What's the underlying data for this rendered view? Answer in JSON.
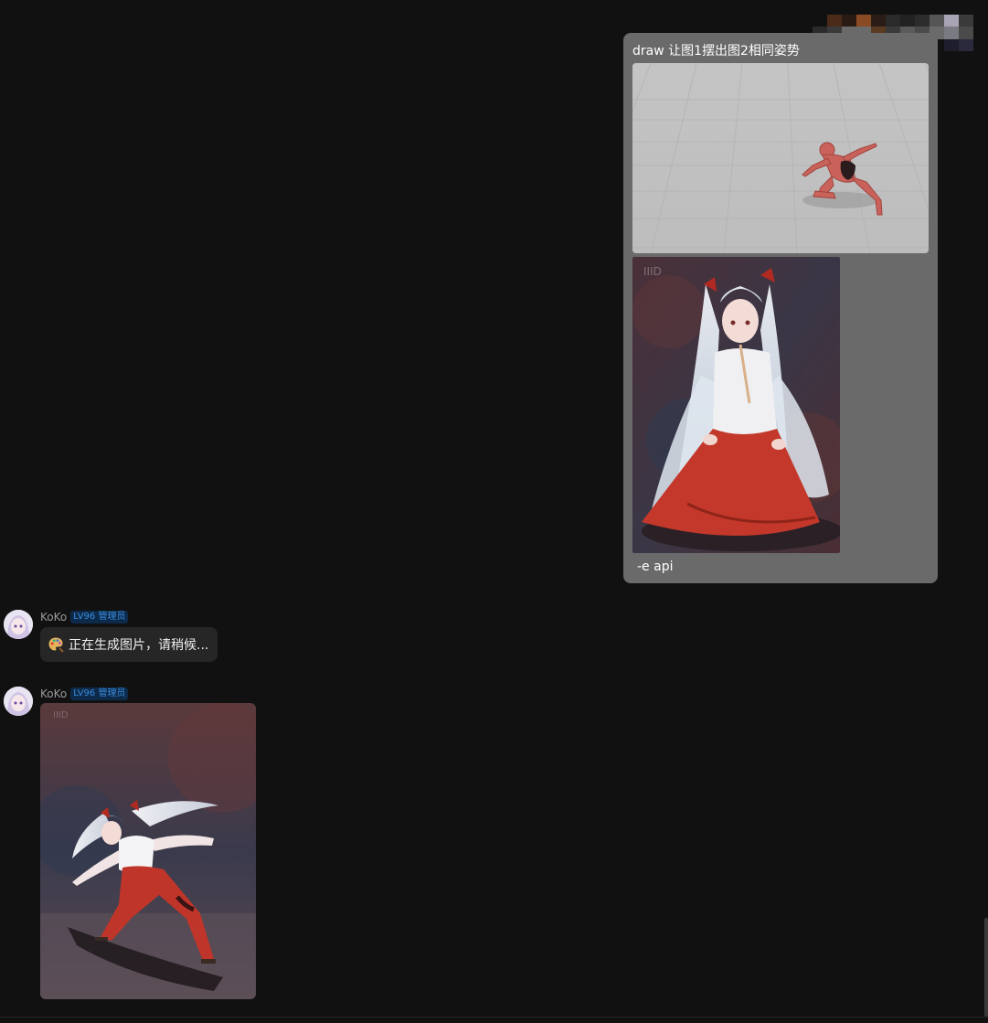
{
  "outgoing": {
    "command_text": "draw 让图1摆出图2相同姿势",
    "trailing_text": "-e api",
    "images": [
      {
        "icon": "pose-mannequin-image"
      },
      {
        "icon": "anime-shrine-maiden-seated-image"
      }
    ]
  },
  "incoming": [
    {
      "sender": "KoKo",
      "badge": "LV96 管理员",
      "text": "正在生成图片，请稍候...",
      "icon": "palette-icon"
    },
    {
      "sender": "KoKo",
      "badge": "LV96 管理员",
      "image": "generated-anime-pose-image"
    }
  ],
  "colors": {
    "background": "#111111",
    "outgoing_bubble": "#6a6a6a",
    "incoming_bubble": "#262626",
    "badge_text": "#3a8cde",
    "badge_bg": "#0d2a4a"
  }
}
